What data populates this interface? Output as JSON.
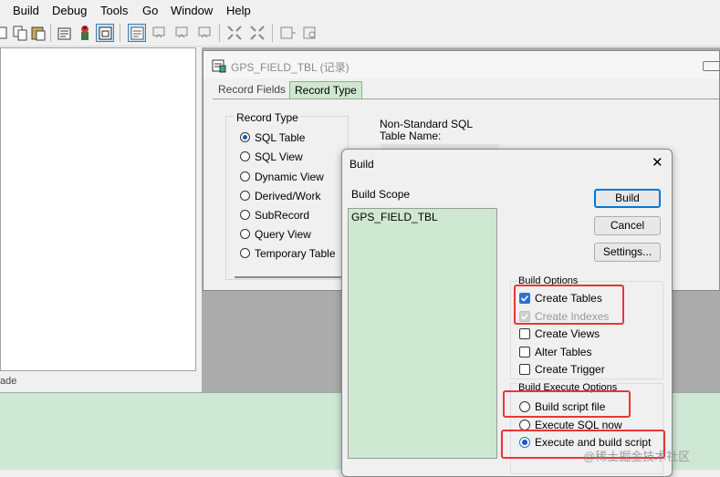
{
  "menu": [
    "Build",
    "Debug",
    "Tools",
    "Go",
    "Window",
    "Help"
  ],
  "left_status": "ade",
  "record_window": {
    "title": "GPS_FIELD_TBL (记录)",
    "tabs": [
      "Record Fields",
      "Record Type"
    ],
    "record_type_group": "Record Type",
    "record_types": [
      {
        "label": "SQL Table",
        "selected": true
      },
      {
        "label": "SQL View",
        "selected": false
      },
      {
        "label": "Dynamic View",
        "selected": false
      },
      {
        "label": "Derived/Work",
        "selected": false
      },
      {
        "label": "SubRecord",
        "selected": false
      },
      {
        "label": "Query View",
        "selected": false
      },
      {
        "label": "Temporary Table",
        "selected": false
      }
    ],
    "nonstandard_sql": "Non-Standard SQL",
    "table_name": "Table Name:"
  },
  "dialog": {
    "title": "Build",
    "close": "✕",
    "build_scope_label": "Build Scope",
    "build_scope_items": [
      "GPS_FIELD_TBL"
    ],
    "buttons": {
      "build": "Build",
      "cancel": "Cancel",
      "settings": "Settings..."
    },
    "build_options_label": "Build Options",
    "build_options": [
      {
        "label": "Create Tables",
        "checked": true,
        "disabled": false
      },
      {
        "label": "Create Indexes",
        "checked": true,
        "disabled": true
      },
      {
        "label": "Create Views",
        "checked": false,
        "disabled": false
      },
      {
        "label": "Alter Tables",
        "checked": false,
        "disabled": false
      },
      {
        "label": "Create Trigger",
        "checked": false,
        "disabled": false
      }
    ],
    "execute_options_label": "Build Execute Options",
    "execute_options": [
      {
        "label": "Build script file",
        "selected": false
      },
      {
        "label": "Execute SQL now",
        "selected": false
      },
      {
        "label": "Execute and build script",
        "selected": true
      }
    ]
  },
  "watermark": "@稀土掘金技术社区",
  "colors": {
    "highlight": "#e8353a",
    "accent": "#2d6fd2",
    "scope_bg": "#cfe8d1",
    "tab_active": "#cde8cf"
  }
}
